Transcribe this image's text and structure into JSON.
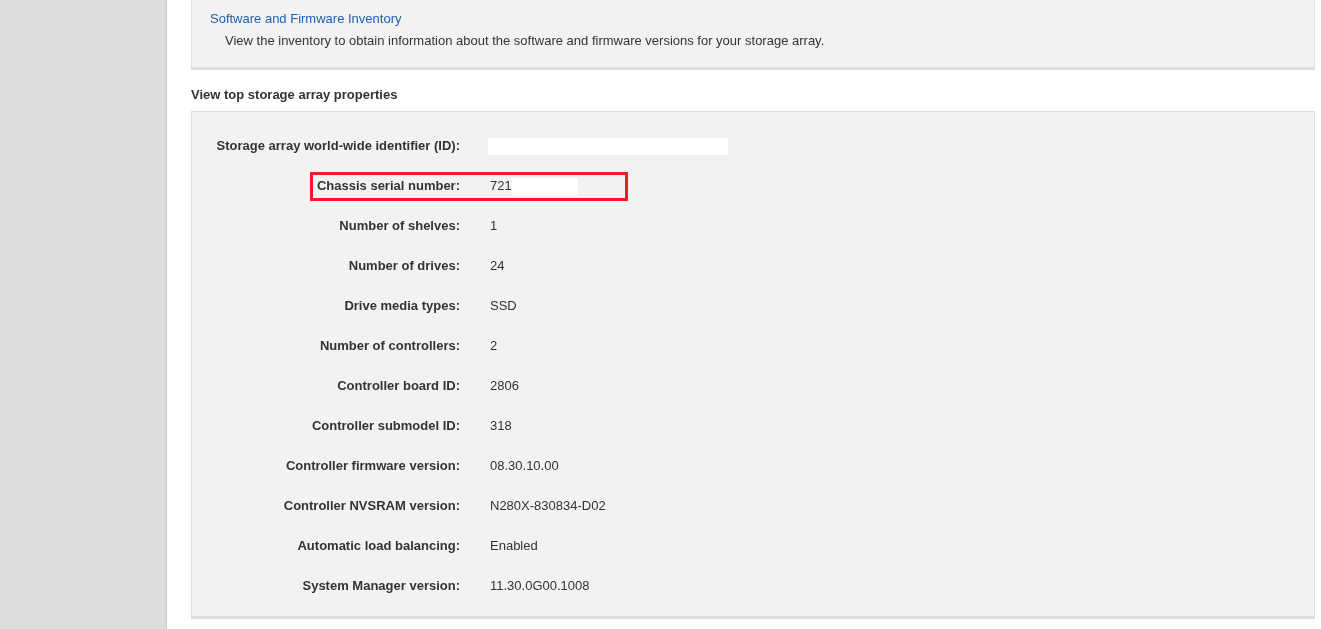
{
  "inventory": {
    "link": "Software and Firmware Inventory",
    "description": "View the inventory to obtain information about the software and firmware versions for your storage array."
  },
  "properties": {
    "heading": "View top storage array properties",
    "rows": [
      {
        "label": "Storage array world-wide identifier (ID):",
        "redacted": true
      },
      {
        "label": "Chassis serial number:",
        "value": "721",
        "redacted": true,
        "highlighted": true
      },
      {
        "label": "Number of shelves:",
        "value": "1"
      },
      {
        "label": "Number of drives:",
        "value": "24"
      },
      {
        "label": "Drive media types:",
        "value": "SSD"
      },
      {
        "label": "Number of controllers:",
        "value": "2"
      },
      {
        "label": "Controller board ID:",
        "value": "2806"
      },
      {
        "label": "Controller submodel ID:",
        "value": "318"
      },
      {
        "label": "Controller firmware version:",
        "value": "08.30.10.00"
      },
      {
        "label": "Controller NVSRAM version:",
        "value": "N280X-830834-D02"
      },
      {
        "label": "Automatic load balancing:",
        "value": "Enabled"
      },
      {
        "label": "System Manager version:",
        "value": "11.30.0G00.1008"
      }
    ]
  }
}
